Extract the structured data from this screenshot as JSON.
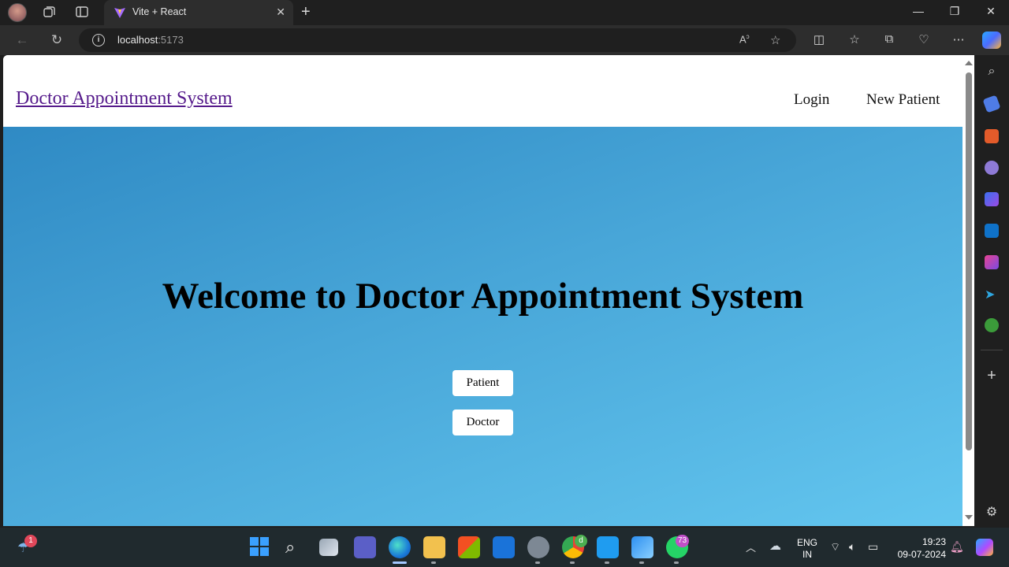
{
  "browser": {
    "tab_title": "Vite + React",
    "url_host": "localhost",
    "url_port": ":5173"
  },
  "site": {
    "brand": "Doctor Appointment System",
    "nav": [
      "Login",
      "New Patient"
    ],
    "hero_title": "Welcome to Doctor Appointment System",
    "buttons": [
      "Patient",
      "Doctor"
    ]
  },
  "taskbar": {
    "weather_badge": "1",
    "chrome_badge": "d",
    "whatsapp_badge": "73",
    "lang_top": "ENG",
    "lang_bottom": "IN",
    "time": "19:23",
    "date": "09-07-2024"
  },
  "icons": {
    "titlebar": [
      "profile-avatar",
      "workspaces-icon",
      "tab-actions-icon",
      "vite-icon",
      "close-icon",
      "new-tab-icon",
      "minimize-icon",
      "restore-icon",
      "window-close-icon"
    ],
    "toolbar": [
      "back-icon",
      "refresh-icon",
      "info-icon",
      "read-aloud-icon",
      "favorite-star-icon",
      "split-screen-icon",
      "favorites-icon",
      "collections-icon",
      "health-icon",
      "more-icon",
      "copilot-icon"
    ],
    "sidebar": [
      "search-icon",
      "shopping-icon",
      "tools-icon",
      "games-icon",
      "bing-icon",
      "outlook-icon",
      "designer-icon",
      "telegram-icon",
      "tree-icon",
      "add-icon",
      "settings-icon"
    ]
  },
  "colors": {
    "hero_start": "#2f8ac4",
    "hero_end": "#63c6ef",
    "brand_link": "#551a8b"
  }
}
